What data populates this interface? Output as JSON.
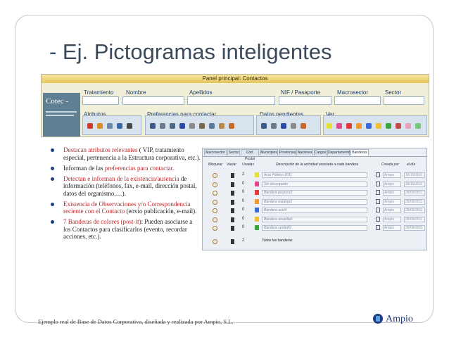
{
  "slide": {
    "title": "- Ej. Pictogramas inteligentes",
    "footer": "Ejemplo real de Base de Datos Corporativa, diseñada y realizada por Ampio, S.L.",
    "brand": "Ampio"
  },
  "panel": {
    "title": "Panel principal: Contactos",
    "logo_text": "Cotec -",
    "fields": {
      "tratamiento": "Tratamiento",
      "nombre": "Nombre",
      "apellidos": "Apellidos",
      "nif": "NIF / Pasaporte",
      "macrosector": "Macrosector",
      "sector": "Sector"
    },
    "sections": {
      "atributos": "Atributos",
      "preferencias": "Preferencias para contactar",
      "datos_pendientes": "Datos pendientes",
      "ver": "Ver"
    }
  },
  "bullets": [
    {
      "parts": [
        {
          "t": "Destacan atributos relevantes",
          "hl": true
        },
        {
          "t": " ( VIP, tratamiento especial, pertenencia a la Estructura corporativa, etc.).",
          "hl": false
        }
      ]
    },
    {
      "parts": [
        {
          "t": "Informan de las ",
          "hl": false
        },
        {
          "t": "preferencias para contactar",
          "hl": true
        },
        {
          "t": ".",
          "hl": false
        }
      ]
    },
    {
      "parts": [
        {
          "t": "Detectan e informan de la existencia/ausencia",
          "hl": true
        },
        {
          "t": " de información (teléfonos, fax, e-mail, dirección postal, datos del organismo,…).",
          "hl": false
        }
      ]
    },
    {
      "parts": [
        {
          "t": "Existencia de Observaciones y/o Correspondencia reciente con el Contacto",
          "hl": true
        },
        {
          "t": " (envío publicación, e-mail).",
          "hl": false
        }
      ]
    },
    {
      "parts": [
        {
          "t": "7 Banderas de colores (post-it)",
          "hl": true
        },
        {
          "t": ": Pueden asociarse a los Contactos para clasificarlos (evento, recordar acciones, etc.).",
          "hl": false
        }
      ]
    }
  ],
  "flags_table": {
    "tabs": [
      "Macrosector",
      "Sector",
      "Cód. Postal",
      "Municipios",
      "Provincias",
      "Naciones",
      "Cargos",
      "Departamentos",
      "Banderas"
    ],
    "active_tab": "Banderas",
    "headers": [
      "Bloquear",
      "Vaciar",
      "Usadas",
      "Descripción de la actividad asociada a cada bandera",
      "Creada por",
      "el día"
    ],
    "rows": [
      {
        "count": "2",
        "flag_color": "#e8e030",
        "desc": "Acto Público 2011",
        "who": "Ampio",
        "date": "18/10/2011"
      },
      {
        "count": "0",
        "flag_color": "#e04a8a",
        "desc": "Sin descripción",
        "who": "Ampio",
        "date": "28/10/2011"
      },
      {
        "count": "0",
        "flag_color": "#e63a3a",
        "desc": "Bandera púrpura3",
        "who": "Ampio",
        "date": "28/09/2011"
      },
      {
        "count": "0",
        "flag_color": "#f09a30",
        "desc": "Bandera naranja3",
        "who": "Ampio",
        "date": "28/09/2011"
      },
      {
        "count": "0",
        "flag_color": "#3a6ad8",
        "desc": "Bandera azul4",
        "who": "Ampio",
        "date": "28/09/2011"
      },
      {
        "count": "0",
        "flag_color": "#f0c030",
        "desc": "Bandera amarilla5",
        "who": "Ampio",
        "date": "28/09/2011"
      },
      {
        "count": "0",
        "flag_color": "#3aa83a",
        "desc": "Bandera verde(6)",
        "who": "Ampio",
        "date": "28/09/2011"
      }
    ],
    "total": {
      "count": "2",
      "label": "Todas las banderas"
    }
  }
}
